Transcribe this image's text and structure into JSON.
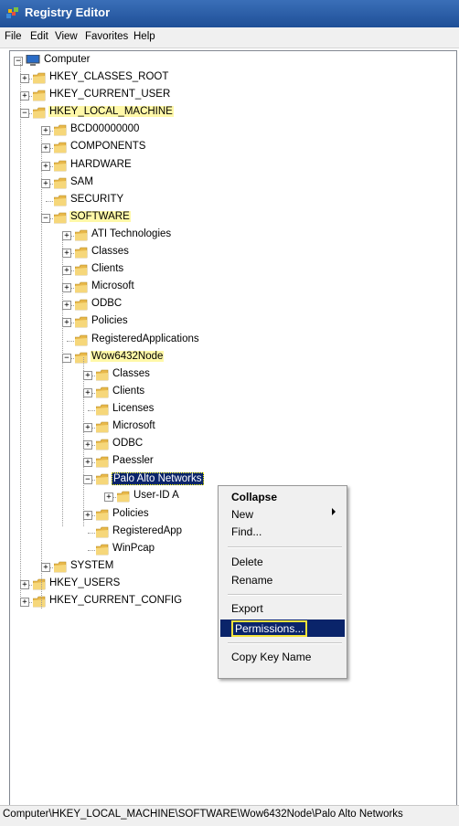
{
  "window": {
    "title": "Registry Editor",
    "icon": "registry-editor-icon"
  },
  "menu": [
    "File",
    "Edit",
    "View",
    "Favorites",
    "Help"
  ],
  "tree": {
    "root": "Computer",
    "nodes": [
      {
        "label": "HKEY_CLASSES_ROOT",
        "level": 1,
        "expander": "+"
      },
      {
        "label": "HKEY_CURRENT_USER",
        "level": 1,
        "expander": "+"
      },
      {
        "label": "HKEY_LOCAL_MACHINE",
        "level": 1,
        "expander": "-",
        "highlight": true
      },
      {
        "label": "BCD00000000",
        "level": 2,
        "expander": "+"
      },
      {
        "label": "COMPONENTS",
        "level": 2,
        "expander": "+"
      },
      {
        "label": "HARDWARE",
        "level": 2,
        "expander": "+"
      },
      {
        "label": "SAM",
        "level": 2,
        "expander": "+"
      },
      {
        "label": "SECURITY",
        "level": 2,
        "expander": ""
      },
      {
        "label": "SOFTWARE",
        "level": 2,
        "expander": "-",
        "highlight": true
      },
      {
        "label": "ATI Technologies",
        "level": 3,
        "expander": "+"
      },
      {
        "label": "Classes",
        "level": 3,
        "expander": "+"
      },
      {
        "label": "Clients",
        "level": 3,
        "expander": "+"
      },
      {
        "label": "Microsoft",
        "level": 3,
        "expander": "+"
      },
      {
        "label": "ODBC",
        "level": 3,
        "expander": "+"
      },
      {
        "label": "Policies",
        "level": 3,
        "expander": "+"
      },
      {
        "label": "RegisteredApplications",
        "level": 3,
        "expander": ""
      },
      {
        "label": "Wow6432Node",
        "level": 3,
        "expander": "-",
        "highlight": true
      },
      {
        "label": "Classes",
        "level": 4,
        "expander": "+"
      },
      {
        "label": "Clients",
        "level": 4,
        "expander": "+"
      },
      {
        "label": "Licenses",
        "level": 4,
        "expander": ""
      },
      {
        "label": "Microsoft",
        "level": 4,
        "expander": "+"
      },
      {
        "label": "ODBC",
        "level": 4,
        "expander": "+"
      },
      {
        "label": "Paessler",
        "level": 4,
        "expander": "+"
      },
      {
        "label": "Palo Alto Networks",
        "level": 4,
        "expander": "-",
        "selected": true
      },
      {
        "label": "User-ID A",
        "level": 5,
        "expander": "+"
      },
      {
        "label": "Policies",
        "level": 4,
        "expander": "+"
      },
      {
        "label": "RegisteredApp",
        "level": 4,
        "expander": ""
      },
      {
        "label": "WinPcap",
        "level": 4,
        "expander": ""
      },
      {
        "label": "SYSTEM",
        "level": 2,
        "expander": "+"
      },
      {
        "label": "HKEY_USERS",
        "level": 1,
        "expander": "+"
      },
      {
        "label": "HKEY_CURRENT_CONFIG",
        "level": 1,
        "expander": "+"
      }
    ]
  },
  "context_menu": {
    "collapse": "Collapse",
    "new": "New",
    "find": "Find...",
    "delete": "Delete",
    "rename": "Rename",
    "export": "Export",
    "permissions": "Permissions...",
    "copy_key_name": "Copy Key Name"
  },
  "status_bar": "Computer\\HKEY_LOCAL_MACHINE\\SOFTWARE\\Wow6432Node\\Palo Alto Networks"
}
